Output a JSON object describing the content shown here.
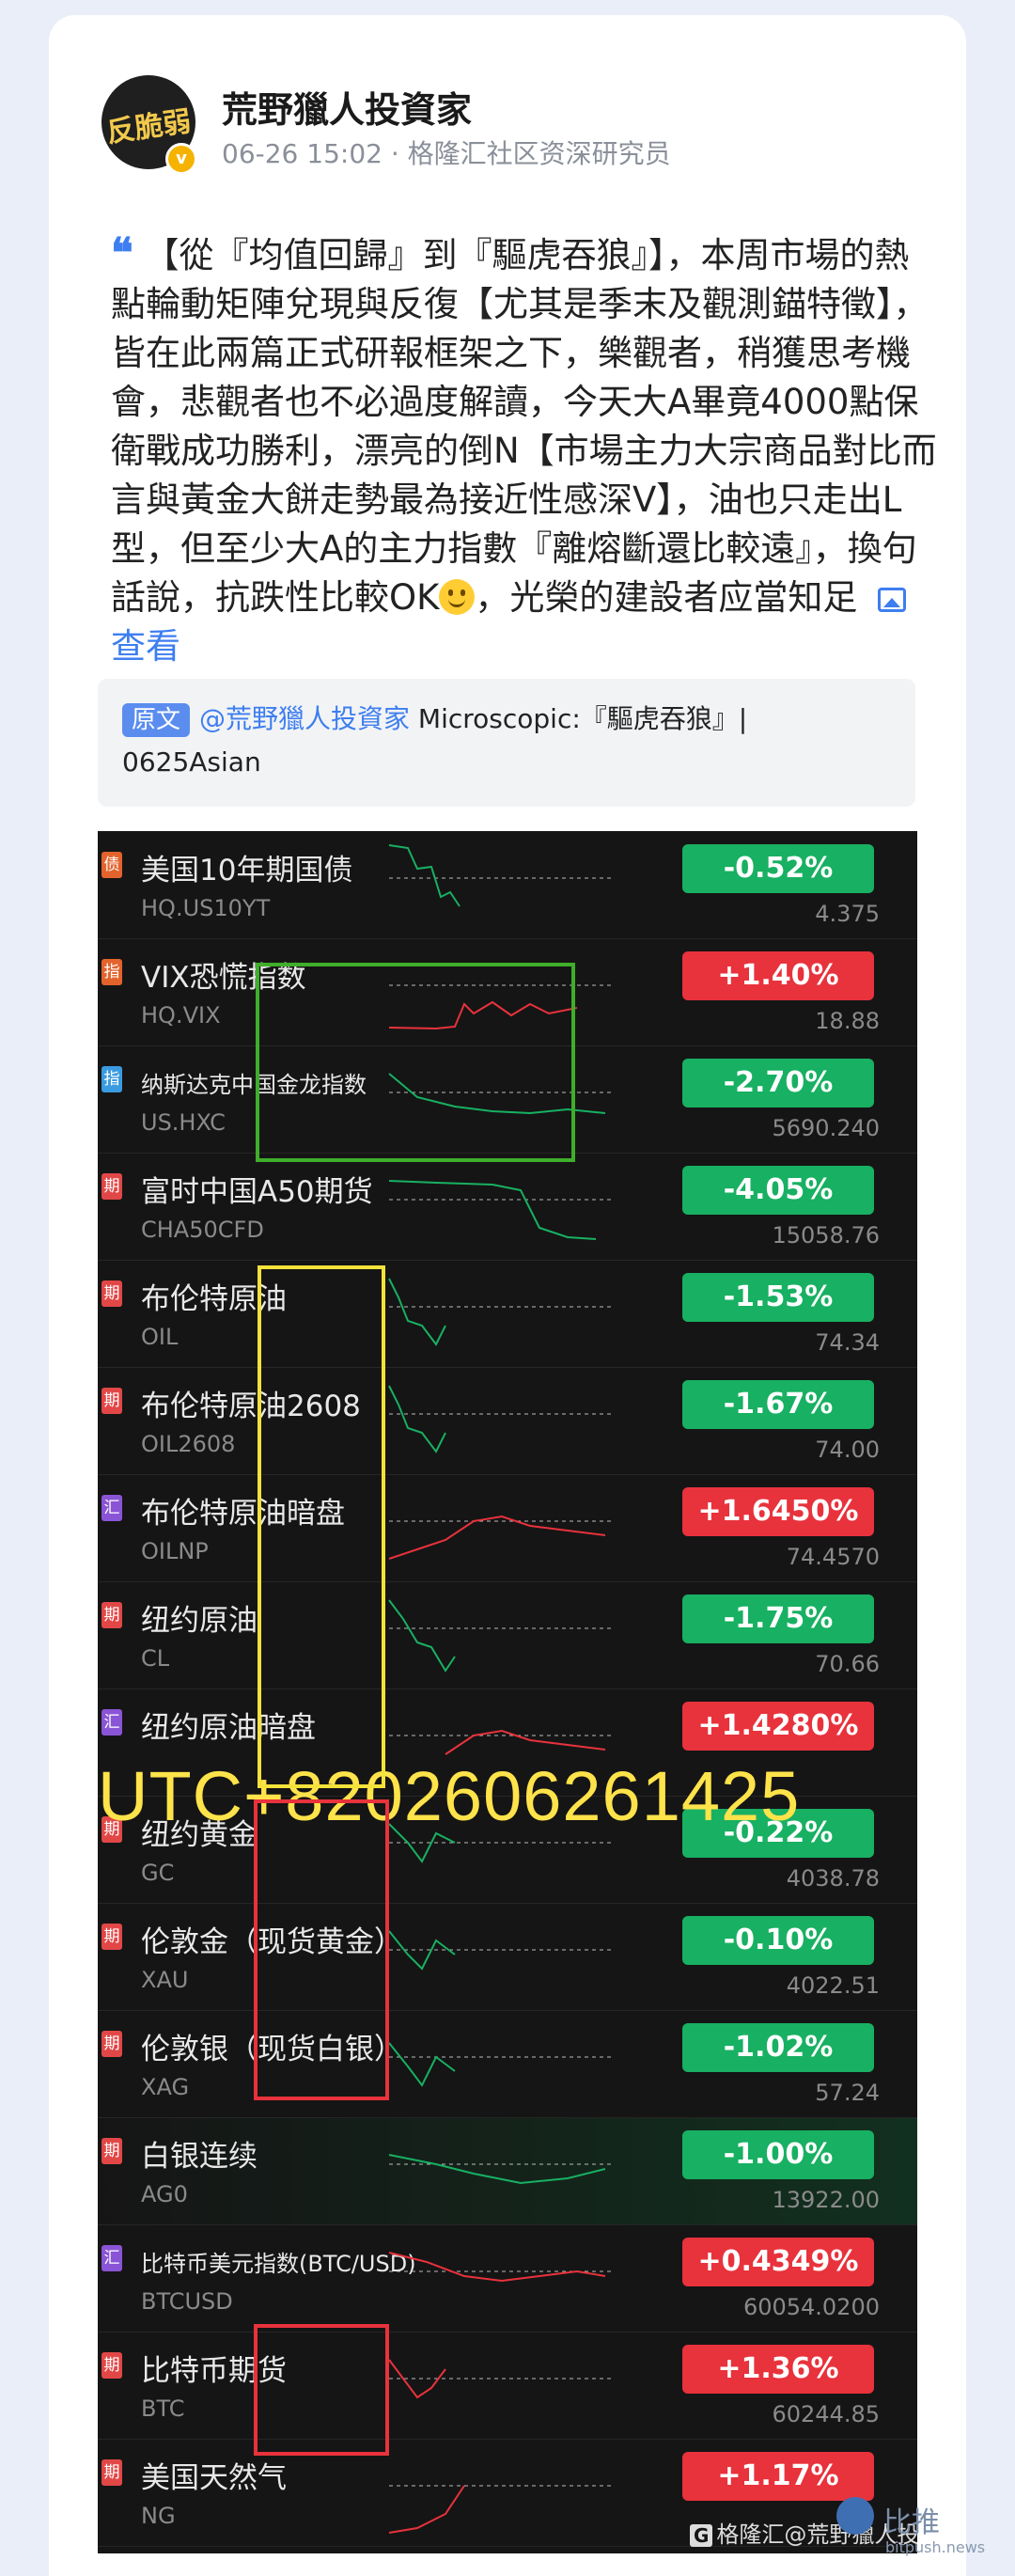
{
  "author": {
    "avatar_text": "反脆弱",
    "name": "荒野獵人投資家",
    "meta": "06-26 15:02 · 格隆汇社区资深研究员"
  },
  "post": {
    "text_part1": "【從『均值回歸』到『驅虎吞狼』】，本周市場的熱點輪動矩陣兌現與反復【尤其是季末及觀測錨特徵】，皆在此兩篇正式研報框架之下，樂觀者，稍獲思考機會，悲觀者也不必過度解讀，今天大A畢竟4000點保衛戰成功勝利，漂亮的倒N【市場主力大宗商品對比而言與黃金大餅走勢最為接近性感深V】，油也只走出L型，但至少大A的主力指數『離熔斷還比較遠』，換句話說，抗跌性比較OK",
    "text_part2": "，光榮的建設者应當知足",
    "view_label": "查看"
  },
  "source": {
    "badge": "原文",
    "author": "@荒野獵人投資家",
    "title": " Microscopic:『驅虎吞狼』|",
    "title2": "0625Asian"
  },
  "markets": [
    {
      "tag": "债",
      "name": "美国10年期国债",
      "code": "HQ.US10YT",
      "change": "-0.52%",
      "price": "4.375",
      "dir": "down"
    },
    {
      "tag": "指",
      "name": "VIX恐慌指数",
      "code": "HQ.VIX",
      "change": "+1.40%",
      "price": "18.88",
      "dir": "up"
    },
    {
      "tag": "指",
      "name": "纳斯达克中国金龙指数",
      "code": "US.HXC",
      "change": "-2.70%",
      "price": "5690.240",
      "dir": "down"
    },
    {
      "tag": "期",
      "name": "富时中国A50期货",
      "code": "CHA50CFD",
      "change": "-4.05%",
      "price": "15058.76",
      "dir": "down"
    },
    {
      "tag": "期",
      "name": "布伦特原油",
      "code": "OIL",
      "change": "-1.53%",
      "price": "74.34",
      "dir": "down"
    },
    {
      "tag": "期",
      "name": "布伦特原油2608",
      "code": "OIL2608",
      "change": "-1.67%",
      "price": "74.00",
      "dir": "down"
    },
    {
      "tag": "汇",
      "name": "布伦特原油暗盘",
      "code": "OILNP",
      "change": "+1.6450%",
      "price": "74.4570",
      "dir": "up"
    },
    {
      "tag": "期",
      "name": "纽约原油",
      "code": "CL",
      "change": "-1.75%",
      "price": "70.66",
      "dir": "down"
    },
    {
      "tag": "汇",
      "name": "纽约原油暗盘",
      "code": "",
      "change": "+1.4280%",
      "price": "",
      "dir": "up"
    },
    {
      "tag": "期",
      "name": "纽约黄金",
      "code": "GC",
      "change": "-0.22%",
      "price": "4038.78",
      "dir": "down"
    },
    {
      "tag": "期",
      "name": "伦敦金（现货黄金）",
      "code": "XAU",
      "change": "-0.10%",
      "price": "4022.51",
      "dir": "down"
    },
    {
      "tag": "期",
      "name": "伦敦银（现货白银）",
      "code": "XAG",
      "change": "-1.02%",
      "price": "57.24",
      "dir": "down"
    },
    {
      "tag": "期",
      "name": "白银连续",
      "code": "AG0",
      "change": "-1.00%",
      "price": "13922.00",
      "dir": "down"
    },
    {
      "tag": "汇",
      "name": "比特币美元指数(BTC/USD)",
      "code": "BTCUSD",
      "change": "+0.4349%",
      "price": "60054.0200",
      "dir": "up"
    },
    {
      "tag": "期",
      "name": "比特币期货",
      "code": "BTC",
      "change": "+1.36%",
      "price": "60244.85",
      "dir": "up"
    },
    {
      "tag": "期",
      "name": "美国天然气",
      "code": "NG",
      "change": "+1.17%",
      "price": "",
      "dir": "up"
    }
  ],
  "overlay_watermark": "UTC+8202606261425",
  "footer": {
    "logo": "G",
    "text": "格隆汇@荒野獵人投資家"
  },
  "site": {
    "name": "比推",
    "url": "bitpush.news"
  },
  "colors": {
    "up": "#e8323c",
    "down": "#18b062",
    "accent": "#3d7ef0"
  }
}
